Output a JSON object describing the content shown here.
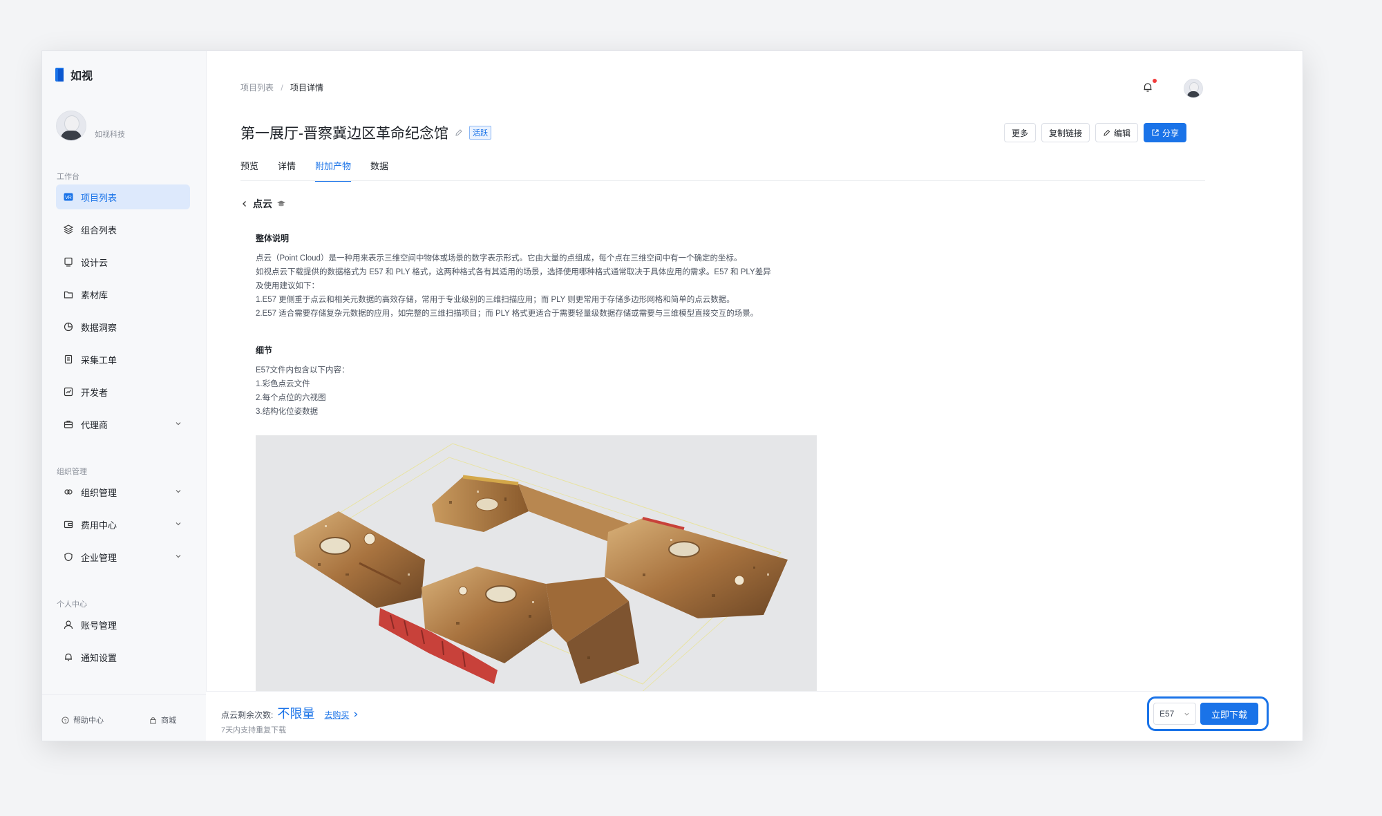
{
  "app": {
    "name": "如视"
  },
  "user": {
    "org_name": "如视科技"
  },
  "sidebar": {
    "sections": [
      {
        "title": "工作台"
      },
      {
        "title": "组织管理"
      },
      {
        "title": "个人中心"
      }
    ],
    "items": [
      {
        "label": "项目列表",
        "icon": "project-list-icon",
        "active": true
      },
      {
        "label": "组合列表",
        "icon": "layers-icon"
      },
      {
        "label": "设计云",
        "icon": "design-cloud-icon"
      },
      {
        "label": "素材库",
        "icon": "folder-icon"
      },
      {
        "label": "数据洞察",
        "icon": "pie-chart-icon"
      },
      {
        "label": "采集工单",
        "icon": "document-icon"
      },
      {
        "label": "开发者",
        "icon": "developer-icon"
      },
      {
        "label": "代理商",
        "icon": "briefcase-icon",
        "expandable": true
      },
      {
        "label": "组织管理",
        "icon": "organization-icon",
        "expandable": true
      },
      {
        "label": "费用中心",
        "icon": "wallet-icon",
        "expandable": true
      },
      {
        "label": "企业管理",
        "icon": "shield-icon",
        "expandable": true
      },
      {
        "label": "账号管理",
        "icon": "user-icon"
      },
      {
        "label": "通知设置",
        "icon": "bell-icon"
      }
    ],
    "footer": {
      "help": "帮助中心",
      "store": "商城"
    }
  },
  "breadcrumb": {
    "parent": "项目列表",
    "separator": "/",
    "current": "项目详情"
  },
  "project": {
    "title": "第一展厅-晋察冀边区革命纪念馆",
    "status": "活跃"
  },
  "actions": {
    "more": "更多",
    "copy_link": "复制链接",
    "edit": "编辑",
    "share": "分享"
  },
  "tabs": [
    {
      "label": "预览"
    },
    {
      "label": "详情"
    },
    {
      "label": "附加产物",
      "active": true
    },
    {
      "label": "数据"
    }
  ],
  "detail": {
    "title": "点云",
    "overview_title": "整体说明",
    "overview_lines": [
      "点云（Point Cloud）是一种用来表示三维空间中物体或场景的数字表示形式。它由大量的点组成，每个点在三维空间中有一个确定的坐标。",
      "如视点云下载提供的数据格式为 E57 和 PLY 格式，这两种格式各有其适用的场景，选择使用哪种格式通常取决于具体应用的需求。E57 和 PLY差异",
      "及使用建议如下：",
      "1.E57 更侧重于点云和相关元数据的高效存储，常用于专业级别的三维扫描应用；而 PLY 则更常用于存储多边形网格和简单的点云数据。",
      "2.E57 适合需要存储复杂元数据的应用，如完整的三维扫描项目；而 PLY 格式更适合于需要轻量级数据存储或需要与三维模型直接交互的场景。"
    ],
    "detail_title": "细节",
    "detail_lines": [
      "E57文件内包含以下内容：",
      "1.彩色点云文件",
      "2.每个点位的六视图",
      "3.结构化位姿数据"
    ]
  },
  "download": {
    "quota_label": "点云剩余次数:",
    "quota_value": "不限量",
    "buy_link": "去购买",
    "note": "7天内支持重复下载",
    "format": "E57",
    "button": "立即下载"
  },
  "colors": {
    "accent": "#1a73e8",
    "sidebar_active_bg": "#dde9fc",
    "alert_dot": "#f23c3c"
  }
}
